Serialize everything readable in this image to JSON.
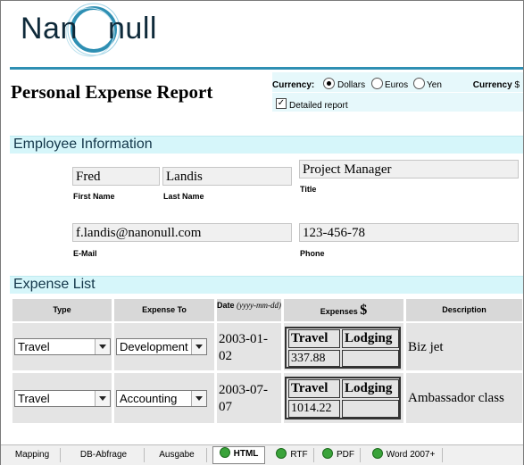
{
  "logo": {
    "left": "Nan",
    "right": "null"
  },
  "title": "Personal Expense Report",
  "options": {
    "currency_label": "Currency:",
    "currencies": [
      "Dollars",
      "Euros",
      "Yen"
    ],
    "selected": "Dollars",
    "currency_right_label": "Currency",
    "currency_right_symbol": "$",
    "detailed_label": "Detailed report",
    "detailed_checked": true
  },
  "employee": {
    "section": "Employee Information",
    "first_name": "Fred",
    "first_name_label": "First Name",
    "last_name": "Landis",
    "last_name_label": "Last Name",
    "title": "Project Manager",
    "title_label": "Title",
    "email": "f.landis@nanonull.com",
    "email_label": "E-Mail",
    "phone": "123-456-78",
    "phone_label": "Phone"
  },
  "expenses": {
    "section": "Expense List",
    "headers": {
      "type": "Type",
      "expense_to": "Expense To",
      "date": "Date",
      "date_format": "(yyyy-mm-dd)",
      "expenses": "Expenses",
      "currency": "$",
      "description": "Description"
    },
    "sub_headers": {
      "travel": "Travel",
      "lodging": "Lodging"
    },
    "rows": [
      {
        "type": "Travel",
        "expense_to": "Development",
        "date": "2003-01-02",
        "travel": "337.88",
        "lodging": "",
        "description": "Biz jet"
      },
      {
        "type": "Travel",
        "expense_to": "Accounting",
        "date": "2003-07-07",
        "travel": "1014.22",
        "lodging": "",
        "description": "Ambassador class"
      }
    ]
  },
  "tabs": [
    {
      "label": "Mapping"
    },
    {
      "label": "DB-Abfrage"
    },
    {
      "label": "Ausgabe"
    },
    {
      "label": "HTML"
    },
    {
      "label": "RTF"
    },
    {
      "label": "PDF"
    },
    {
      "label": "Word 2007+"
    }
  ],
  "colors": {
    "accent": "#2e8fb3",
    "section_bg": "#d6f6fa",
    "options_bg": "#e6f8fb",
    "table_bg": "#e4e4e4",
    "header_bg": "#d8d8d8",
    "tab_icon": "#3aa33a"
  }
}
